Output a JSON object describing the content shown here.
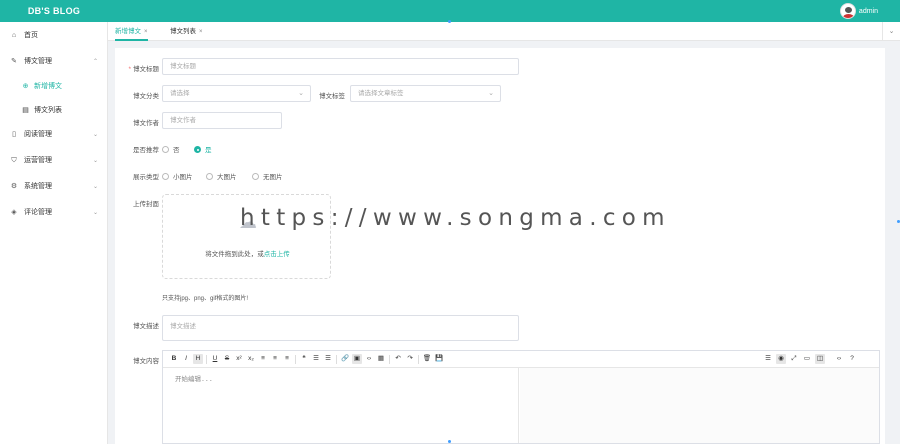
{
  "header": {
    "brand": "DB'S BLOG",
    "username": "admin"
  },
  "sidebar": {
    "items": [
      {
        "label": "首页",
        "icon": "home-icon"
      },
      {
        "label": "博文管理",
        "icon": "edit-doc-icon",
        "expanded": true,
        "children": [
          {
            "label": "新增博文",
            "icon": "plus-circle-icon",
            "active": true
          },
          {
            "label": "博文列表",
            "icon": "list-icon"
          }
        ]
      },
      {
        "label": "阅读管理",
        "icon": "book-icon"
      },
      {
        "label": "运营管理",
        "icon": "shield-icon"
      },
      {
        "label": "系统管理",
        "icon": "gear-icon"
      },
      {
        "label": "评论管理",
        "icon": "comment-icon"
      }
    ]
  },
  "tabs": [
    {
      "label": "新增博文",
      "close": "×",
      "active": true
    },
    {
      "label": "博文列表",
      "close": "×",
      "active": false
    }
  ],
  "tabs_more_glyph": "⌄",
  "form": {
    "title": {
      "label": "博文标题",
      "required_mark": "*",
      "placeholder": "博文标题"
    },
    "category": {
      "label": "博文分类",
      "placeholder": "请选择",
      "caret": "⌄"
    },
    "tags": {
      "label": "博文标签",
      "placeholder": "请选择文章标签",
      "caret": "⌄"
    },
    "author": {
      "label": "博文作者",
      "placeholder": "博文作者"
    },
    "recommend": {
      "label": "是否推荐",
      "options": [
        "否",
        "是"
      ],
      "selected": "是"
    },
    "display": {
      "label": "展示类型",
      "options": [
        "小图片",
        "大图片",
        "无图片"
      ],
      "selected": null
    },
    "upload": {
      "label": "上传封面",
      "hint_prefix": "将文件拖到此处，或",
      "hint_link": "点击上传",
      "tip": "只支持jpg、png、gif格式的图片!"
    },
    "description": {
      "label": "博文描述",
      "placeholder": "博文描述"
    },
    "content": {
      "label": "博文内容",
      "placeholder": "开始编辑..."
    }
  },
  "toolbar": {
    "left": [
      "B",
      "I",
      "H",
      "U",
      "S",
      "x²",
      "x₂",
      "≡",
      "≡",
      "≡",
      "❝",
      "☰",
      "☰",
      "🔗",
      "▣",
      "‹›",
      "▦",
      "↶",
      "↷",
      "🗑",
      "💾"
    ],
    "right": [
      "☰",
      "◉",
      "⤢",
      "▭",
      "◫",
      "‹›",
      "?"
    ]
  },
  "watermark": "https://www.songma.com"
}
